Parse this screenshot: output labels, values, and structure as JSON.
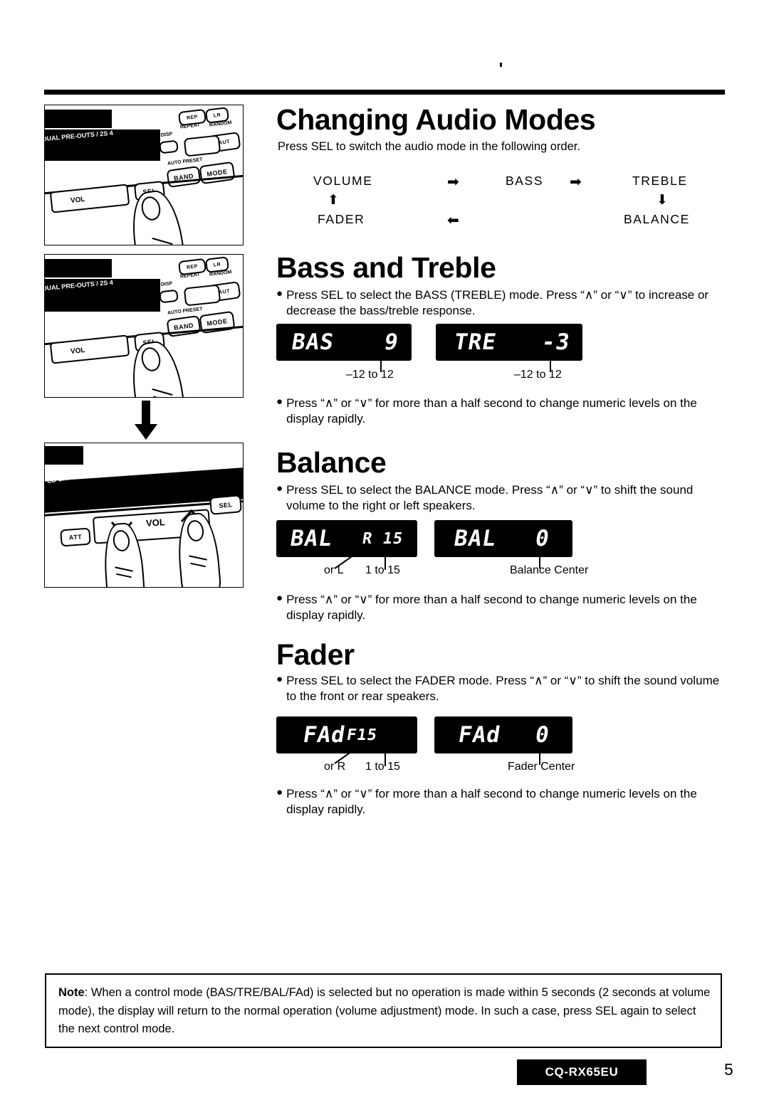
{
  "page": {
    "number": "5",
    "model": "CQ-RX65EU"
  },
  "sections": {
    "changing_audio_modes": {
      "heading": "Changing Audio Modes",
      "lead": "Press SEL to switch the audio mode in the following order.",
      "flow": {
        "volume": "VOLUME",
        "bass": "BASS",
        "treble": "TREBLE",
        "balance": "BALANCE",
        "fader": "FADER",
        "arrow_right_1": "➡",
        "arrow_right_2": "➡",
        "arrow_down": "⬇",
        "arrow_left": "⬅",
        "arrow_up": "⬆"
      }
    },
    "bass_and_treble": {
      "heading": "Bass and Treble",
      "bullet1": "Press SEL to select the BASS (TREBLE) mode. Press “∧” or “∨” to increase or decrease the bass/treble response.",
      "bullet2": "Press “∧” or “∨” for more than a half second to change numeric levels on the display rapidly.",
      "displays": [
        {
          "label": "BAS",
          "value": "9",
          "caption": "–12 to 12"
        },
        {
          "label": "TRE",
          "value": "-3",
          "caption": "–12 to 12"
        }
      ]
    },
    "balance": {
      "heading": "Balance",
      "bullet1": "Press SEL to select the BALANCE mode. Press “∧” or “∨” to shift the sound volume to the right or left speakers.",
      "bullet2": "Press “∧” or “∨” for more than a half second to change numeric levels on the display rapidly.",
      "displays": [
        {
          "label": "BAL",
          "value": "R 15",
          "caption_left": "or L",
          "caption_right": "1 to 15"
        },
        {
          "label": "BAL",
          "value": "0",
          "caption": "Balance Center"
        }
      ]
    },
    "fader": {
      "heading": "Fader",
      "bullet1": "Press SEL to select the FADER mode. Press “∧” or “∨” to shift the sound volume to the front or rear speakers.",
      "bullet2": "Press “∧” or “∨” for more than a half second to change numeric levels on the display rapidly.",
      "displays": [
        {
          "label": "FAd",
          "value": "F15",
          "caption_left": "or R",
          "caption_right": "1 to 15"
        },
        {
          "label": "FAd",
          "value": "0",
          "caption": "Fader Center"
        }
      ]
    }
  },
  "note": {
    "label": "Note",
    "text": ": When a control mode (BAS/TRE/BAL/FAd) is selected but no operation is made within 5 seconds (2 seconds at volume mode), the display will return to the normal operation (volume adjustment) mode. In such a case, press SEL again to select the next control mode."
  },
  "photos": [
    {
      "caption_hidden": "Finger pressing SEL button on head unit",
      "faceplate_labels": {
        "brand_strip": "DUAL PRE-OUTS / 2S 4",
        "rep": "REP",
        "lr": "LR",
        "repeat": "REPEAT",
        "random": "RANDOM",
        "disp": "DISP",
        "aut": "AUT",
        "auto_preset": "AUTO PRESET",
        "band": "BAND",
        "mode": "MODE",
        "sel": "SEL",
        "vol": "VOL"
      }
    },
    {
      "caption_hidden": "Finger pressing SEL button on head unit",
      "faceplate_labels": {
        "brand_strip": "DUAL PRE-OUTS / 2S 4",
        "rep": "REP",
        "lr": "LR",
        "repeat": "REPEAT",
        "random": "RANDOM",
        "disp": "DISP",
        "aut": "AUT",
        "auto_preset": "AUTO PRESET",
        "band": "BAND",
        "mode": "MODE",
        "sel": "SEL",
        "vol": "VOL"
      }
    },
    {
      "caption_hidden": "Two fingers pressing VOL up and down buttons",
      "faceplate_labels": {
        "brand_strip": "CD CHANGER CONTROL / DUAL PRE-OUT",
        "att": "ATT",
        "vol": "VOL",
        "sel": "SEL"
      }
    }
  ]
}
